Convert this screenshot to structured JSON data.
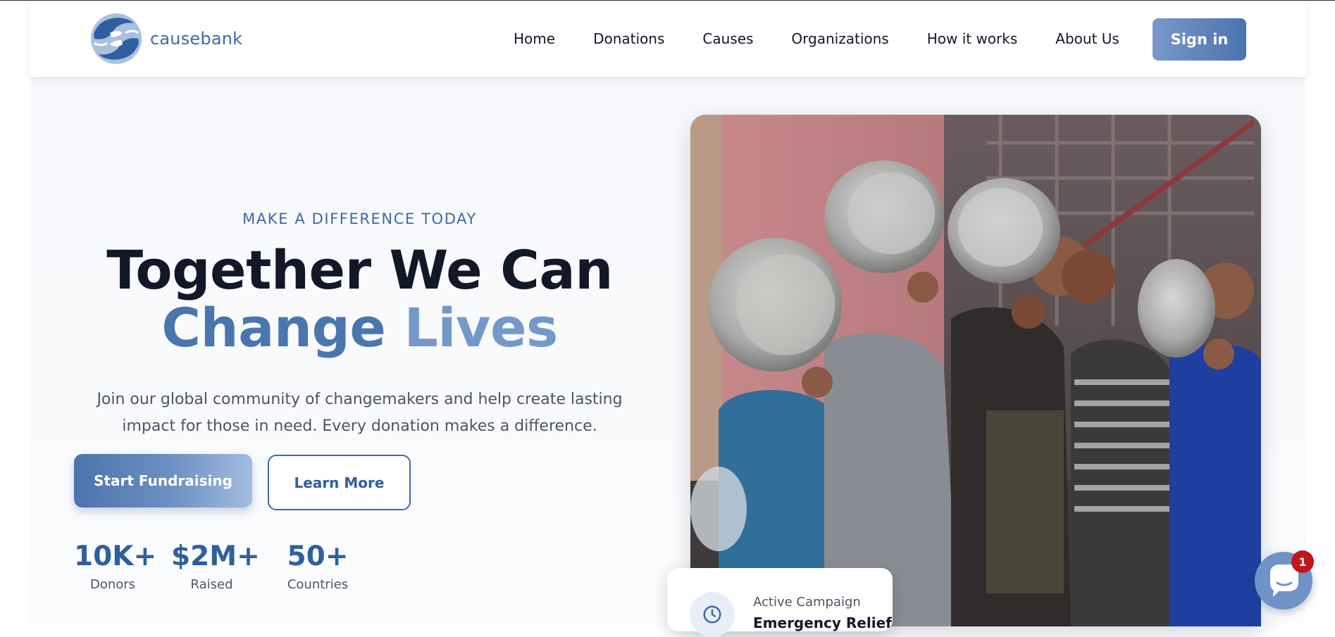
{
  "brand": {
    "name": "causebank"
  },
  "nav": {
    "items": [
      "Home",
      "Donations",
      "Causes",
      "Organizations",
      "How it works",
      "About Us"
    ],
    "signin_label": "Sign in"
  },
  "hero": {
    "eyebrow": "MAKE A DIFFERENCE TODAY",
    "headline_line1": "Together We Can",
    "headline_word1": "Change",
    "headline_word2": "Lives",
    "subtext": "Join our global community of changemakers and help create lasting impact for those in need. Every donation makes a difference.",
    "primary_button": "Start Fundraising",
    "secondary_button": "Learn More",
    "stats": [
      {
        "value": "10K+",
        "label": "Donors"
      },
      {
        "value": "$2M+",
        "label": "Raised"
      },
      {
        "value": "50+",
        "label": "Countries"
      }
    ]
  },
  "campaign": {
    "label": "Active Campaign",
    "title": "Emergency Relief",
    "icon": "clock-icon"
  },
  "chat": {
    "icon": "chat-bubble-icon",
    "badge_count": "1"
  },
  "colors": {
    "accent": "#3d6aa6",
    "accent_light": "#7499c9",
    "heading": "#111827",
    "badge": "#c2141b"
  }
}
